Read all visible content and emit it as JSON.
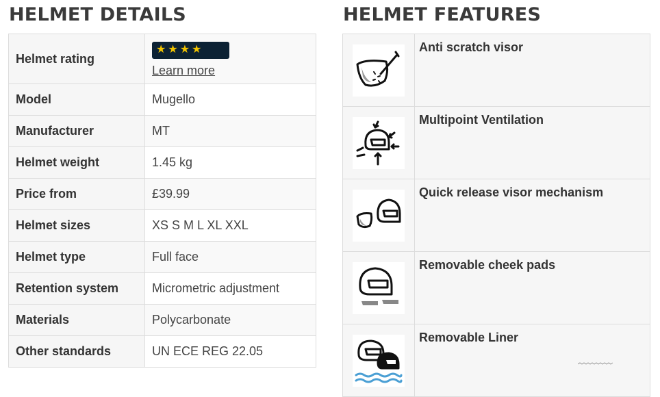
{
  "details": {
    "title": "HELMET DETAILS",
    "rating": {
      "label": "Helmet rating",
      "stars": 4,
      "stars_text": "★★★★",
      "learn_more": "Learn more"
    },
    "rows": [
      {
        "label": "Model",
        "value": "Mugello"
      },
      {
        "label": "Manufacturer",
        "value": "MT"
      },
      {
        "label": "Helmet weight",
        "value": "1.45 kg"
      },
      {
        "label": "Price from",
        "value": "£39.99"
      },
      {
        "label": "Helmet sizes",
        "value": "XS S M L XL XXL"
      },
      {
        "label": "Helmet type",
        "value": "Full face"
      },
      {
        "label": "Retention system",
        "value": "Micrometric adjustment"
      },
      {
        "label": "Materials",
        "value": "Polycarbonate"
      },
      {
        "label": "Other standards",
        "value": "UN ECE REG 22.05"
      }
    ]
  },
  "features": {
    "title": "HELMET FEATURES",
    "items": [
      {
        "label": "Anti scratch visor",
        "icon": "anti-scratch-visor-icon"
      },
      {
        "label": "Multipoint Ventilation",
        "icon": "ventilation-icon"
      },
      {
        "label": "Quick release visor mechanism",
        "icon": "quick-release-visor-icon"
      },
      {
        "label": "Removable cheek pads",
        "icon": "cheek-pads-icon"
      },
      {
        "label": "Removable Liner",
        "icon": "removable-liner-icon"
      }
    ]
  },
  "colors": {
    "rating_bg": "#0c2234",
    "star": "#f2c400",
    "border": "#dcdcdc",
    "cell_bg": "#f6f6f6"
  }
}
